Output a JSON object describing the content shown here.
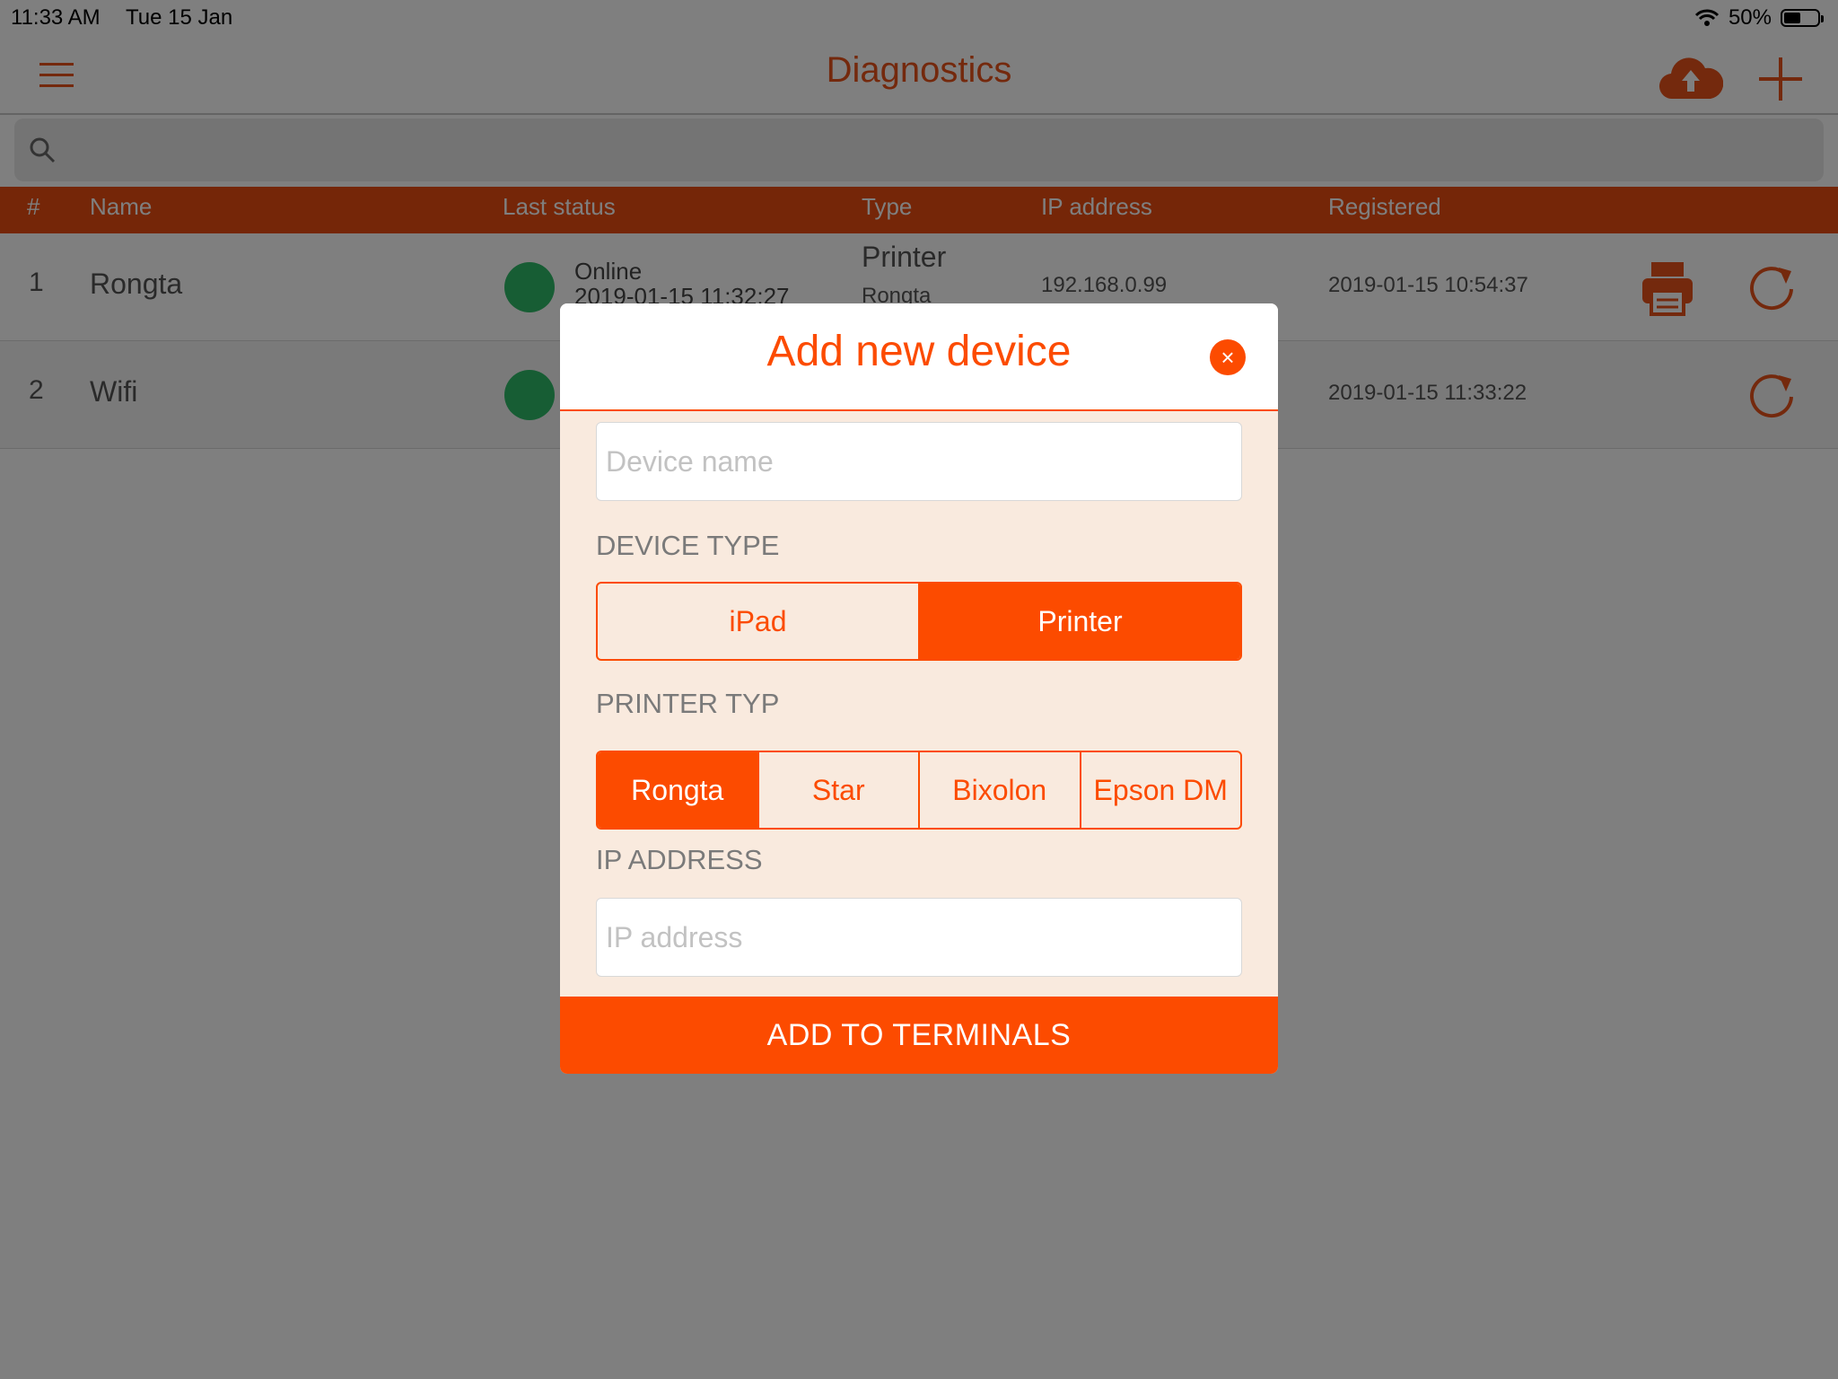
{
  "status_bar": {
    "time": "11:33 AM",
    "date": "Tue 15 Jan",
    "battery": "50%",
    "battery_level": 0.5
  },
  "header": {
    "title": "Diagnostics"
  },
  "search": {
    "placeholder": ""
  },
  "table": {
    "columns": [
      "#",
      "Name",
      "Last status",
      "Type",
      "IP address",
      "Registered"
    ],
    "rows": [
      {
        "num": "1",
        "name": "Rongta",
        "status": "Online",
        "status_time": "2019-01-15 11:32:27",
        "type": "Printer",
        "type_sub": "Rongta",
        "ip": "192.168.0.99",
        "registered": "2019-01-15 10:54:37"
      },
      {
        "num": "2",
        "name": "Wifi",
        "registered": "2019-01-15 11:33:22"
      }
    ]
  },
  "modal": {
    "title": "Add new device",
    "close": "×",
    "device_name_placeholder": "Device name",
    "device_type_label": "DEVICE TYPE",
    "device_types": [
      "iPad",
      "Printer"
    ],
    "device_type_selected": "Printer",
    "printer_type_label": "PRINTER TYP",
    "printer_types": [
      "Rongta",
      "Star",
      "Bixolon",
      "Epson DM"
    ],
    "printer_type_selected": "Rongta",
    "ip_label": "IP ADDRESS",
    "ip_placeholder": "IP address",
    "submit": "ADD TO TERMINALS"
  },
  "colors": {
    "accent": "#fc4b00",
    "header_bar": "#ea4c10",
    "online": "#2fbb68",
    "modal_bg": "#f9eade"
  }
}
